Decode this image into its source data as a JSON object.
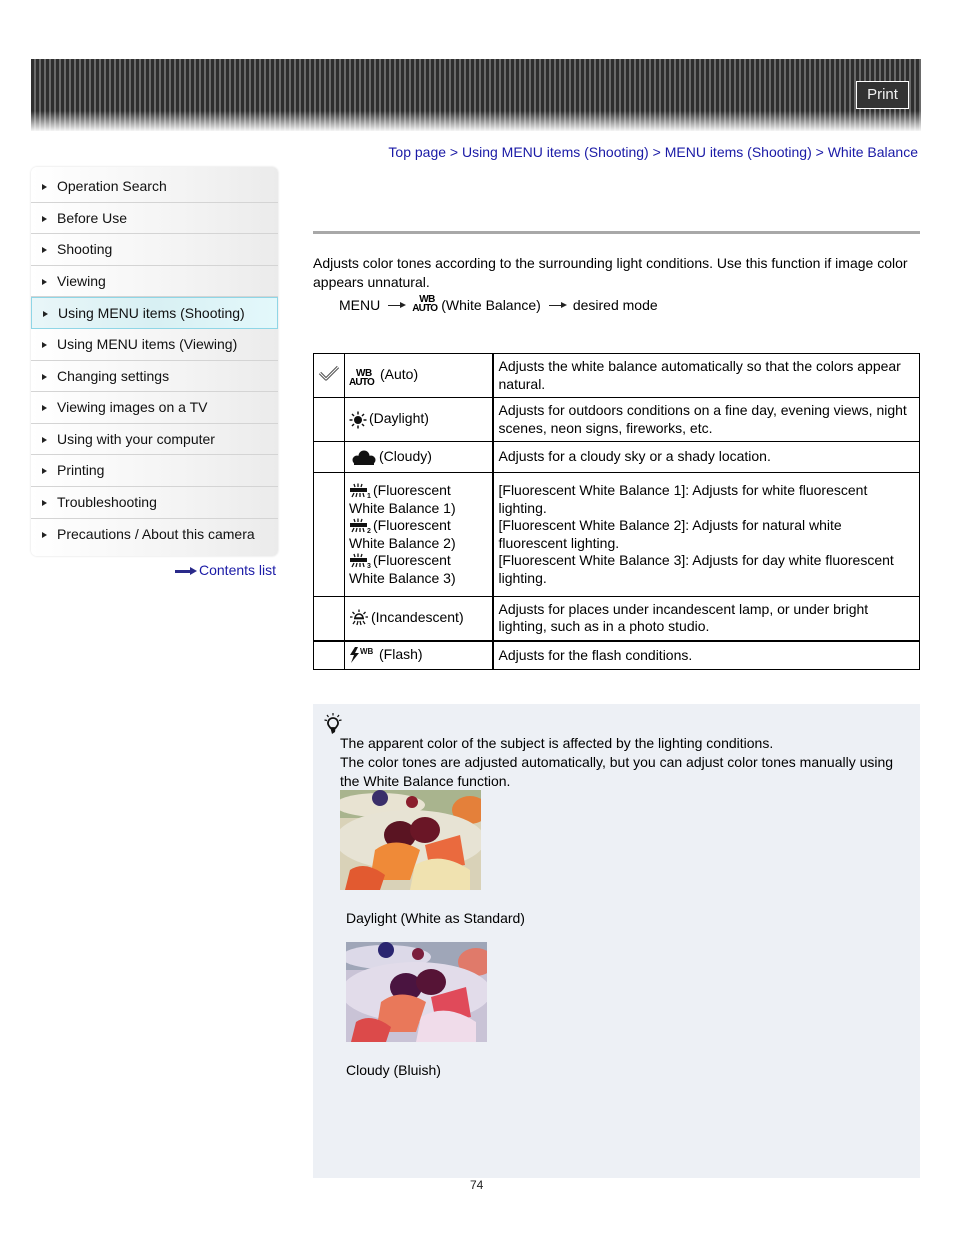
{
  "header": {
    "print_label": "Print"
  },
  "sidebar": {
    "items": [
      {
        "label": "Operation Search",
        "active": false
      },
      {
        "label": "Before Use",
        "active": false
      },
      {
        "label": "Shooting",
        "active": false
      },
      {
        "label": "Viewing",
        "active": false
      },
      {
        "label": "Using MENU items (Shooting)",
        "active": true
      },
      {
        "label": "Using MENU items (Viewing)",
        "active": false
      },
      {
        "label": "Changing settings",
        "active": false
      },
      {
        "label": "Viewing images on a TV",
        "active": false
      },
      {
        "label": "Using with your computer",
        "active": false
      },
      {
        "label": "Printing",
        "active": false
      },
      {
        "label": "Troubleshooting",
        "active": false
      },
      {
        "label": "Precautions / About this camera",
        "active": false
      }
    ],
    "contents_link": "Contents list"
  },
  "breadcrumb": {
    "items": [
      "Top page",
      "Using MENU items (Shooting)",
      "MENU items (Shooting)",
      "White Balance"
    ],
    "separator": " > "
  },
  "intro": {
    "text": "Adjusts color tones according to the surrounding light conditions. Use this function if image color appears unnatural.",
    "menu_path": {
      "menu": "MENU",
      "icon_wb_top": "WB",
      "icon_wb_bottom": "AUTO",
      "item": "(White Balance)",
      "target": "desired mode"
    }
  },
  "table": {
    "rows": [
      {
        "icon": "wb-auto-icon",
        "label": "(Auto)",
        "selected": true,
        "description": "Adjusts the white balance automatically so that the colors appear natural."
      },
      {
        "icon": "daylight-icon",
        "label": "(Daylight)",
        "selected": false,
        "description": "Adjusts for outdoors conditions on a fine day, evening views, night scenes, neon signs, fireworks, etc."
      },
      {
        "icon": "cloudy-icon",
        "label": "(Cloudy)",
        "selected": false,
        "description": "Adjusts for a cloudy sky or a shady location."
      },
      {
        "fluorescent": [
          {
            "icon": "fluorescent-1-icon",
            "label_a": "(Fluorescent",
            "label_b": "White Balance 1)",
            "description_a": "[Fluorescent White Balance 1]: Adjusts for white fluorescent",
            "description_b": "lighting."
          },
          {
            "icon": "fluorescent-2-icon",
            "label_a": "(Fluorescent",
            "label_b": "White Balance 2)",
            "description_a": "[Fluorescent White Balance 2]: Adjusts for natural white",
            "description_b": "fluorescent lighting."
          },
          {
            "icon": "fluorescent-3-icon",
            "label_a": "(Fluorescent",
            "label_b": "White Balance 3)",
            "description_a": "[Fluorescent White Balance 3]: Adjusts for day white fluorescent",
            "description_b": "lighting."
          }
        ]
      },
      {
        "icon": "incandescent-icon",
        "label": "(Incandescent)",
        "selected": false,
        "description": "Adjusts for places under incandescent lamp, or under bright lighting, such as in a photo studio."
      },
      {
        "icon": "flash-wb-icon",
        "label": "(Flash)",
        "selected": false,
        "description": "Adjusts for the flash conditions."
      }
    ]
  },
  "hint": {
    "line1": "The apparent color of the subject is affected by the lighting conditions.",
    "line2": "The color tones are adjusted automatically, but you can adjust color tones manually using the White Balance function.",
    "photos": [
      {
        "caption": "Daylight (White as Standard)"
      },
      {
        "caption": "Cloudy (Bluish)"
      }
    ]
  },
  "footer": {
    "page_number": "74"
  }
}
